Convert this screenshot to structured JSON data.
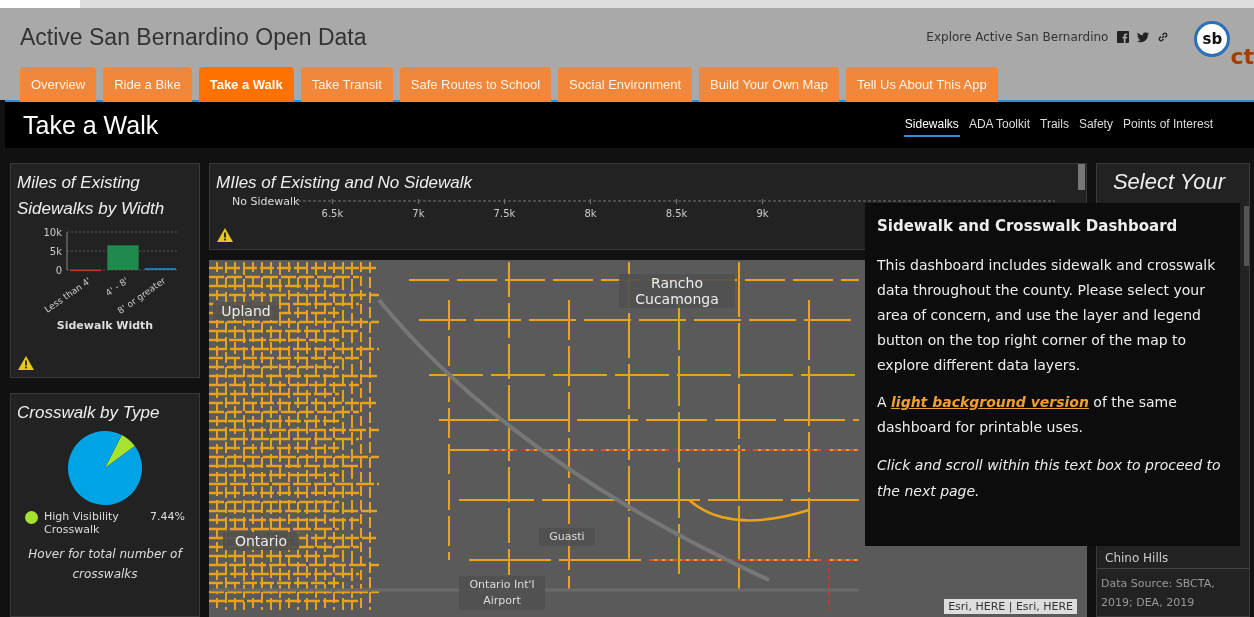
{
  "header": {
    "title": "Active San Bernardino Open Data",
    "explore_link": "Explore Active San Bernardino",
    "logo": {
      "text": "sb",
      "suffix": "ct"
    }
  },
  "tabs": [
    {
      "label": "Overview",
      "selected": false
    },
    {
      "label": "Ride a Bike",
      "selected": false
    },
    {
      "label": "Take a Walk",
      "selected": true
    },
    {
      "label": "Take Transit",
      "selected": false
    },
    {
      "label": "Safe Routes to School",
      "selected": false
    },
    {
      "label": "Social Environment",
      "selected": false
    },
    {
      "label": "Build Your Own Map",
      "selected": false
    },
    {
      "label": "Tell Us About This App",
      "selected": false
    }
  ],
  "page_title": "Take a Walk",
  "subnav": [
    {
      "label": "Sidewalks",
      "selected": true
    },
    {
      "label": "ADA Toolkit",
      "selected": false
    },
    {
      "label": "Trails",
      "selected": false
    },
    {
      "label": "Safety",
      "selected": false
    },
    {
      "label": "Points of Interest",
      "selected": false
    }
  ],
  "width_panel": {
    "title": "Miles of Existing Sidewalks by Width",
    "chart_data": {
      "type": "bar",
      "stacked": true,
      "xlabel": "Sidewalk Width",
      "categories": [
        "Less than 4'",
        "4' - 8'",
        "8' or greater"
      ],
      "series": [
        {
          "color": "#c0392b",
          "values": [
            100,
            null,
            null
          ]
        },
        {
          "color": "#1f8a4c",
          "values": [
            null,
            6500,
            null
          ]
        },
        {
          "color": "#1a7fc1",
          "values": [
            null,
            null,
            500
          ]
        }
      ],
      "ylim": [
        0,
        10000
      ],
      "yticks": [
        {
          "value": 0,
          "label": "0"
        },
        {
          "value": 5000,
          "label": "5k"
        },
        {
          "value": 10000,
          "label": "10k"
        }
      ]
    }
  },
  "crosswalk_panel": {
    "title": "Crosswalk by Type",
    "chart_data": {
      "type": "pie",
      "values": [
        7.44,
        92.56
      ],
      "colors": [
        "#a6e22e",
        "#00a3e3"
      ]
    },
    "legend": [
      {
        "label": "High Visibility Crosswalk",
        "value": "7.44%",
        "color": "#a6e22e"
      }
    ],
    "note": "Hover for total number of crosswalks"
  },
  "sidewalk_panel": {
    "title": "MIles of Existing and No Sidewalk",
    "chart_data": {
      "type": "bar",
      "orientation": "horizontal",
      "categories": [
        "No Sidewalk"
      ],
      "values": [
        null
      ],
      "xlim": [
        6300,
        10700
      ],
      "xticks": [
        {
          "value": 6500,
          "label": "6.5k"
        },
        {
          "value": 7000,
          "label": "7k"
        },
        {
          "value": 7500,
          "label": "7.5k"
        },
        {
          "value": 8000,
          "label": "8k"
        },
        {
          "value": 8500,
          "label": "8.5k"
        },
        {
          "value": 9000,
          "label": "9k"
        }
      ]
    }
  },
  "map": {
    "places": [
      {
        "name": "Rancho Cucamonga",
        "kind": "city"
      },
      {
        "name": "Upland",
        "kind": "city"
      },
      {
        "name": "Ontario",
        "kind": "city"
      },
      {
        "name": "Guasti",
        "kind": "small"
      },
      {
        "name": "Ontario Int'l Airport",
        "kind": "small"
      }
    ],
    "attribution": "Esri, HERE | Esri, HERE"
  },
  "city_panel": {
    "title": "Select Your",
    "items": [
      "Chino Hills"
    ],
    "source": "Data Source: SBCTA, 2019; DEA, 2019"
  },
  "popup": {
    "title": "Sidewalk and Crosswalk Dashboard",
    "body": "This dashboard includes sidewalk and crosswalk data throughout the county. Please select your area of concern, and use the layer and legend button on the top right corner of the map to explore different data layers.",
    "link_before": "A",
    "link": "light background version",
    "link_after": "of the same dashboard for printable uses.",
    "hint": "Click and scroll within this text box to proceed to the next page."
  }
}
